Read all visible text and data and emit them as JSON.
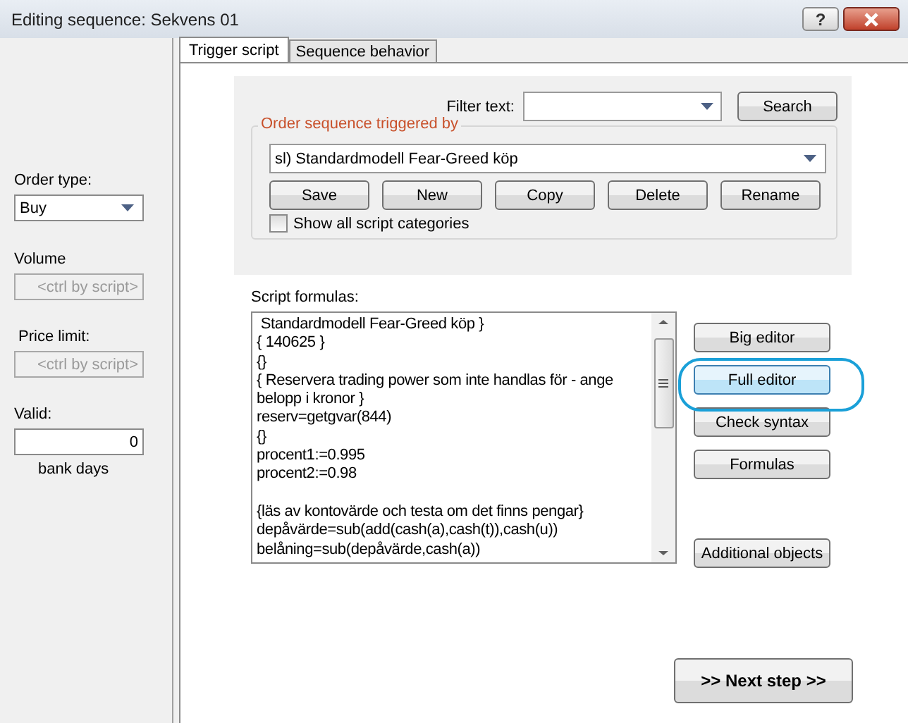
{
  "window": {
    "title": "Editing sequence: Sekvens 01",
    "help_button": "?"
  },
  "sidebar": {
    "order_type": {
      "label": "Order type:",
      "value": "Buy"
    },
    "volume": {
      "label": "Volume",
      "placeholder": "<ctrl by script>",
      "disabled": true
    },
    "price_limit": {
      "label": "Price limit:",
      "placeholder": "<ctrl by script>",
      "disabled": true
    },
    "valid": {
      "label": "Valid:",
      "value": "0",
      "unit": "bank days"
    }
  },
  "tabs": [
    {
      "label": "Trigger script",
      "selected": true
    },
    {
      "label": "Sequence behavior",
      "selected": false
    }
  ],
  "filter": {
    "label": "Filter text:",
    "search_button": "Search"
  },
  "trigger_group": {
    "title": "Order sequence triggered by",
    "selected_script": "sl) Standardmodell Fear-Greed köp",
    "buttons": [
      "Save",
      "New",
      "Copy",
      "Delete",
      "Rename"
    ],
    "show_all": {
      "label": "Show all script categories",
      "checked": false
    }
  },
  "script": {
    "label": "Script formulas:",
    "lines": [
      {
        "text": " Standardmodell Fear-Greed köp }",
        "gap_before": false
      },
      {
        "text": "{ 140625 }",
        "gap_before": false
      },
      {
        "text": "{}",
        "gap_before": false
      },
      {
        "text": "{ Reservera trading power som inte handlas för - ange",
        "gap_before": false
      },
      {
        "text": "belopp i kronor }",
        "gap_before": false
      },
      {
        "text": "reserv=getgvar(844)",
        "gap_before": false
      },
      {
        "text": "{}",
        "gap_before": false
      },
      {
        "text": "procent1:=0.995",
        "gap_before": false
      },
      {
        "text": "procent2:=0.98",
        "gap_before": false
      },
      {
        "text": "{läs av kontovärde och testa om det finns pengar}",
        "gap_before": true
      },
      {
        "text": "depåvärde=sub(add(cash(a),cash(t)),cash(u))",
        "gap_before": false
      },
      {
        "text": "belåning=sub(depåvärde,cash(a))",
        "gap_before": false
      }
    ]
  },
  "side_buttons": [
    {
      "label": "Big editor",
      "highlighted": false
    },
    {
      "label": "Full editor",
      "highlighted": true
    },
    {
      "label": "Check syntax",
      "highlighted": false
    },
    {
      "label": "Formulas",
      "highlighted": false
    }
  ],
  "additional_objects_button": "Additional objects",
  "next_button": ">> Next step >>"
}
